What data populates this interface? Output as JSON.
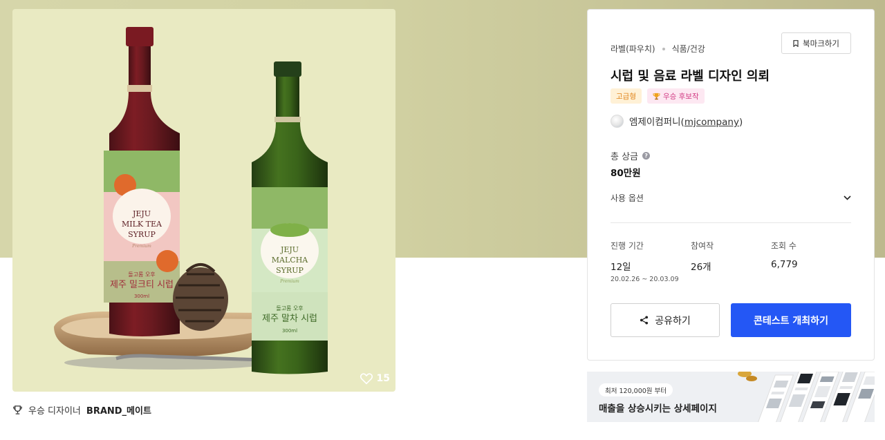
{
  "artwork": {
    "like_count": "15",
    "left_bottle": {
      "line1": "JEJU",
      "line2": "MILK TEA",
      "line3": "SYRUP",
      "small": "Premium",
      "brand": "돌고롬 오후",
      "product": "제주 밀크티 시럽",
      "volume": "300ml"
    },
    "right_bottle": {
      "line1": "JEJU",
      "line2": "MALCHA",
      "line3": "SYRUP",
      "small": "Premium",
      "brand": "돌고롬 오후",
      "product": "제주 말차 시럽",
      "volume": "300ml"
    }
  },
  "designer": {
    "prefix": "우승 디자이너",
    "name": "BRAND_메이트"
  },
  "panel": {
    "category_main": "라벨(파우치)",
    "category_sub": "식품/건강",
    "bookmark_label": "북마크하기",
    "title": "시럽 및 음료 라벨 디자인 의뢰",
    "badge_premium": "고급형",
    "badge_winner": "우승 후보작",
    "company_name": "엠제이컴퍼니",
    "company_handle": "mjcompany",
    "prize_label": "총 상금",
    "prize_help": "?",
    "prize_value": "80만원",
    "usage_label": "사용 옵션",
    "stats": [
      {
        "label": "진행 기간",
        "value": "12일",
        "sub": "20.02.26  ~  20.03.09"
      },
      {
        "label": "참여작",
        "value": "26개"
      },
      {
        "label": "조회 수",
        "value": "6,779"
      }
    ],
    "share_label": "공유하기",
    "host_label": "콘테스트 개최하기"
  },
  "ad": {
    "pill": "최저 120,000원 부터",
    "text": "매출을 상승시키는 상세페이지"
  },
  "colors": {
    "primary": "#2457f5",
    "premium_badge_bg": "#fff1d6",
    "premium_badge_fg": "#e0851c",
    "winner_badge_bg": "#fde8f2",
    "winner_badge_fg": "#d13a83",
    "hero_bg": "#d2d2a3"
  }
}
